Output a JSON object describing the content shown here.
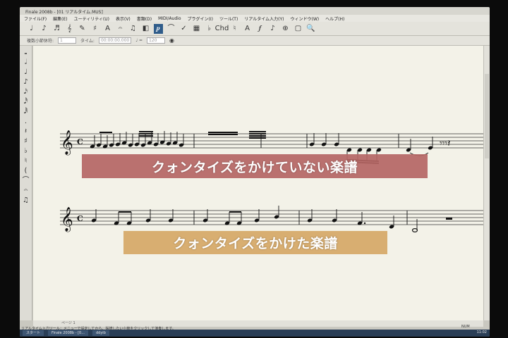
{
  "window": {
    "title": "Finale 2008b - [01 リアルタイム.MUS]"
  },
  "menu": {
    "items": [
      "ファイル(F)",
      "編集(E)",
      "ユーティリティ(U)",
      "表示(V)",
      "書類(D)",
      "MIDI/Audio",
      "プラグイン(I)",
      "ツール(T)",
      "リアルタイム入力(Y)",
      "ウィンドウ(W)",
      "ヘルプ(H)"
    ]
  },
  "toolbar": {
    "tools": [
      "♩",
      "♪",
      "♬",
      "𝄞",
      "✎",
      "♯",
      "A",
      "𝄐",
      "♫",
      "◧",
      "𝆏",
      "⌒",
      "✓",
      "▦",
      "♭",
      "Chd",
      "♮",
      "A",
      "𝆑",
      "♪",
      "⊕",
      "▢",
      "🔍"
    ],
    "active_index": 10
  },
  "toolbar2": {
    "label_measure": "複数小節休符:",
    "field_measure": "1",
    "label_time": "タイム:",
    "field_time": "00:00:00.000",
    "label_tempo": "♩ =",
    "field_tempo": "120"
  },
  "palette": {
    "items": [
      "𝅝",
      "𝅗𝅥",
      "♩",
      "♪",
      "𝅘𝅥𝅯",
      "𝅘𝅥𝅰",
      "𝅘𝅥𝅱",
      ".",
      "𝄽",
      "♯",
      "♭",
      "♮",
      "(",
      "⌒",
      "𝄐",
      "♫"
    ]
  },
  "captions": {
    "unquantized": "クォンタイズをかけていない楽譜",
    "quantized": "クォンタイズをかけた楽譜"
  },
  "scrollbar": {
    "page_label": "ページ 1"
  },
  "status": {
    "hint": "リアルタイム入力ツール：メニューで設定してから、採譜したい小節をクリックして演奏します。",
    "num": "NUM"
  },
  "taskbar": {
    "start": "スタート",
    "items": [
      "Finale 2008b - [0...",
      "ddyib"
    ],
    "clock": "11:02"
  }
}
